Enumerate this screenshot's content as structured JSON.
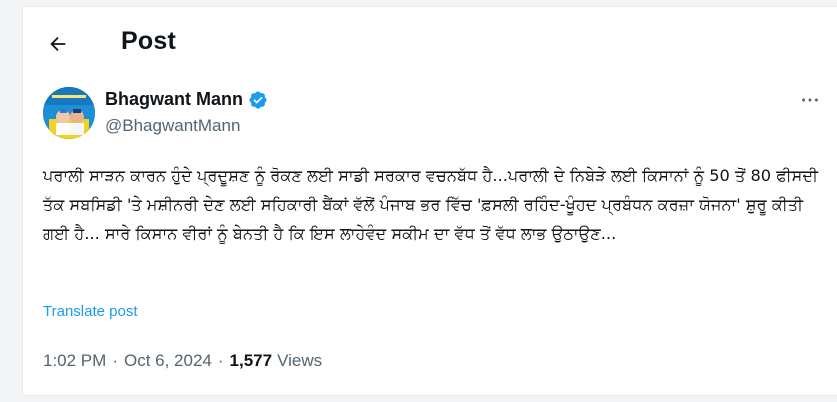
{
  "header": {
    "title": "Post",
    "back_icon": "arrow-left-icon"
  },
  "author": {
    "name": "Bhagwant Mann",
    "handle": "@BhagwantMann",
    "verified_color": "#1d9bf0",
    "more_icon": "more-horizontal-icon"
  },
  "post": {
    "text": "ਪਰਾਲੀ ਸਾੜਨ ਕਾਰਨ ਹੁੰਦੇ ਪ੍ਰਦੂਸ਼ਣ ਨੂੰ ਰੋਕਣ ਲਈ ਸਾਡੀ ਸਰਕਾਰ ਵਚਨਬੱਧ ਹੈ...ਪਰਾਲੀ ਦੇ ਨਿਬੇੜੇ ਲਈ ਕਿਸਾਨਾਂ ਨੂੰ 50 ਤੋਂ 80 ਫੀਸਦੀ ਤੱਕ ਸਬਸਿਡੀ 'ਤੇ ਮਸ਼ੀਨਰੀ ਦੇਣ ਲਈ ਸਹਿਕਾਰੀ ਬੈਂਕਾਂ ਵੱਲੋਂ ਪੰਜਾਬ ਭਰ ਵਿੱਚ 'ਫ਼ਸਲੀ ਰਹਿੰਦ-ਖੂੰਹਦ ਪ੍ਰਬੰਧਨ ਕਰਜ਼ਾ ਯੋਜਨਾ' ਸ਼ੁਰੂ ਕੀਤੀ ਗਈ ਹੈ... ਸਾਰੇ ਕਿਸਾਨ ਵੀਰਾਂ ਨੂੰ ਬੇਨਤੀ ਹੈ ਕਿ ਇਸ ਲਾਹੇਵੰਦ ਸਕੀਮ ਦਾ ਵੱਧ ਤੋਂ ਵੱਧ ਲਾਭ ਉਠਾਉਣ...",
    "translate_label": "Translate post"
  },
  "meta": {
    "time": "1:02 PM",
    "separator": "·",
    "date": "Oct 6, 2024",
    "views_count": "1,577",
    "views_label": "Views"
  }
}
